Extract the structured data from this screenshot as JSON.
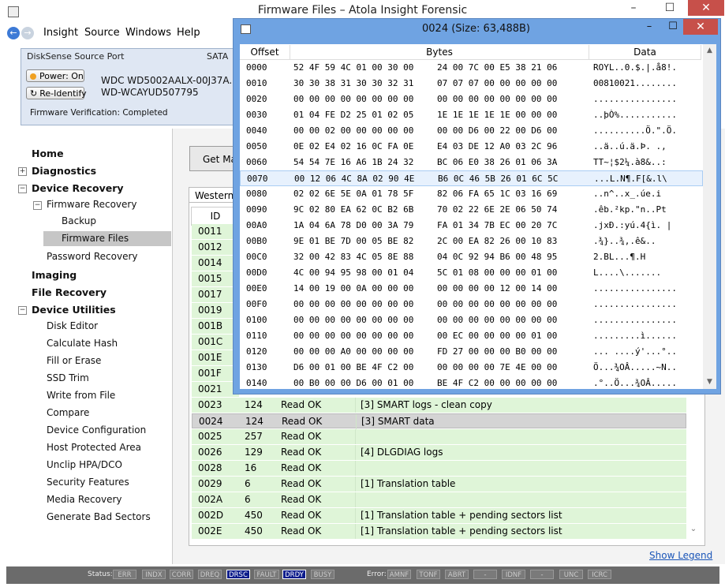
{
  "window": {
    "title": "Firmware Files – Atola Insight Forensic",
    "minimize": "–",
    "maximize": "☐",
    "close": "✕"
  },
  "nav_buttons": {
    "back": "←",
    "forward": "→"
  },
  "menu": [
    "Insight",
    "Source",
    "Windows",
    "Help"
  ],
  "source": {
    "title": "DiskSense Source Port",
    "interface": "SATA",
    "power_button": "Power: On",
    "reidentify_button": "Re-Identify",
    "model": "WDC WD5002AALX-00J37A...",
    "serial": "WD-WCAYUD507795",
    "fw_verification": "Firmware Verification: Completed"
  },
  "sidebar": {
    "home": "Home",
    "diagnostics": "Diagnostics",
    "device_recovery": "Device Recovery",
    "firmware_recovery": "Firmware Recovery",
    "backup": "Backup",
    "firmware_files": "Firmware Files",
    "password_recovery": "Password Recovery",
    "imaging": "Imaging",
    "file_recovery": "File Recovery",
    "device_utilities": "Device Utilities",
    "utilities": [
      "Disk Editor",
      "Calculate Hash",
      "Fill or Erase",
      "SSD Trim",
      "Write from File",
      "Compare",
      "Device Configuration",
      "Host Protected Area",
      "Unclip HPA/DCO",
      "Security Features",
      "Media Recovery",
      "Generate Bad Sectors"
    ],
    "expanders": {
      "collapsed": "+",
      "expanded": "−"
    }
  },
  "main": {
    "get_map_button": "Get Ma",
    "tab_label": "Western I",
    "id_header": "ID",
    "id_list": [
      "0011",
      "0012",
      "0014",
      "0015",
      "0017",
      "0019",
      "001B",
      "001C",
      "001E",
      "001F",
      "0021"
    ],
    "rows": [
      {
        "id": "0023",
        "size": "124",
        "status": "Read OK",
        "desc": "[3] SMART logs - clean copy"
      },
      {
        "id": "0024",
        "size": "124",
        "status": "Read OK",
        "desc": "[3] SMART data"
      },
      {
        "id": "0025",
        "size": "257",
        "status": "Read OK",
        "desc": ""
      },
      {
        "id": "0026",
        "size": "129",
        "status": "Read OK",
        "desc": "[4] DLGDIAG logs"
      },
      {
        "id": "0028",
        "size": "16",
        "status": "Read OK",
        "desc": ""
      },
      {
        "id": "0029",
        "size": "6",
        "status": "Read OK",
        "desc": "[1] Translation table"
      },
      {
        "id": "002A",
        "size": "6",
        "status": "Read OK",
        "desc": ""
      },
      {
        "id": "002D",
        "size": "450",
        "status": "Read OK",
        "desc": "[1] Translation table + pending sectors list"
      },
      {
        "id": "002E",
        "size": "450",
        "status": "Read OK",
        "desc": "[1] Translation table + pending sectors list"
      }
    ],
    "scroll_down": "⌄",
    "show_legend": "Show Legend"
  },
  "status_bar": {
    "status_label": "Status:",
    "status_indicators": [
      {
        "label": "ERR",
        "on": false
      },
      {
        "label": "INDX",
        "on": false
      },
      {
        "label": "CORR",
        "on": false
      },
      {
        "label": "DREQ",
        "on": false
      },
      {
        "label": "DRSC",
        "on": true
      },
      {
        "label": "FAULT",
        "on": false
      },
      {
        "label": "DRDY",
        "on": true
      },
      {
        "label": "BUSY",
        "on": false
      }
    ],
    "error_label": "Error:",
    "error_indicators": [
      "AMNF",
      "TONF",
      "ABRT",
      "-",
      "IDNF",
      "-",
      "UNC",
      "ICRC"
    ]
  },
  "hex_window": {
    "title": "0024 (Size: 63,488B)",
    "minimize": "–",
    "maximize": "☐",
    "close": "✕",
    "headers": [
      "Offset",
      "Bytes",
      "Data"
    ],
    "scroll_up": "▲",
    "scroll_down": "▼",
    "rows": [
      {
        "offset": "0000",
        "b1": "52 4F 59 4C 01 00 30 00",
        "b2": "24 00 7C 00 E5 38 21 06",
        "data": "ROYL..0.$.|.å8!."
      },
      {
        "offset": "0010",
        "b1": "30 30 38 31 30 30 32 31",
        "b2": "07 07 07 00 00 00 00 00",
        "data": "00810021........"
      },
      {
        "offset": "0020",
        "b1": "00 00 00 00 00 00 00 00",
        "b2": "00 00 00 00 00 00 00 00",
        "data": "................"
      },
      {
        "offset": "0030",
        "b1": "01 04 FE D2 25 01 02 05",
        "b2": "1E 1E 1E 1E 1E 00 00 00",
        "data": "..þÒ%..........."
      },
      {
        "offset": "0040",
        "b1": "00 00 02 00 00 00 00 00",
        "b2": "00 00 D6 00 22 00 D6 00",
        "data": "..........Ö.\".Ö."
      },
      {
        "offset": "0050",
        "b1": "0E 02 E4 02 16 0C FA 0E",
        "b2": "E4 03 DE 12 A0 03 2C 96",
        "data": "..ä..ú.ä.Þ. .,"
      },
      {
        "offset": "0060",
        "b1": "54 54 7E 16 A6 1B 24 32",
        "b2": "BC 06 E0 38 26 01 06 3A",
        "data": "TT~¦$2¼.à8&..:"
      },
      {
        "offset": "0070",
        "b1": "00 12 06 4C 8A 02 90 4E",
        "b2": "B6 0C 46 5B 26 01 6C 5C",
        "data": "...L.N¶.F[&.l\\"
      },
      {
        "offset": "0080",
        "b1": "02 02 6E 5E 0A 01 78 5F",
        "b2": "82 06 FA 65 1C 03 16 69",
        "data": "..n^..x_.úe.i"
      },
      {
        "offset": "0090",
        "b1": "9C 02 80 EA 62 0C B2 6B",
        "b2": "70 02 22 6E 2E 06 50 74",
        "data": ".êb.²kp.\"n..Pt"
      },
      {
        "offset": "00A0",
        "b1": "1A 04 6A 78 D0 00 3A 79",
        "b2": "FA 01 34 7B EC 00 20 7C",
        "data": ".jxÐ.:yú.4{ì. |"
      },
      {
        "offset": "00B0",
        "b1": "9E 01 BE 7D 00 05 BE 82",
        "b2": "2C 00 EA 82 26 00 10 83",
        "data": ".¾}..¾,.ê&.."
      },
      {
        "offset": "00C0",
        "b1": "32 00 42 83 4C 05 8E 88",
        "b2": "04 0C 92 94 B6 00 48 95",
        "data": "2.BL...¶.H"
      },
      {
        "offset": "00D0",
        "b1": "4C 00 94 95 98 00 01 04",
        "b2": "5C 01 08 00 00 00 01 00",
        "data": "L....\\......."
      },
      {
        "offset": "00E0",
        "b1": "14 00 19 00 0A 00 00 00",
        "b2": "00 00 00 00 12 00 14 00",
        "data": "................"
      },
      {
        "offset": "00F0",
        "b1": "00 00 00 00 00 00 00 00",
        "b2": "00 00 00 00 00 00 00 00",
        "data": "................"
      },
      {
        "offset": "0100",
        "b1": "00 00 00 00 00 00 00 00",
        "b2": "00 00 00 00 00 00 00 00",
        "data": "................"
      },
      {
        "offset": "0110",
        "b1": "00 00 00 00 00 00 00 00",
        "b2": "00 EC 00 00 00 00 01 00",
        "data": ".........ì......"
      },
      {
        "offset": "0120",
        "b1": "00 00 00 A0 00 00 00 00",
        "b2": "FD 27 00 00 00 B0 00 00",
        "data": "... ....ý'...°.."
      },
      {
        "offset": "0130",
        "b1": "D6 00 01 00 BE 4F C2 00",
        "b2": "00 00 00 00 7E 4E 00 00",
        "data": "Ö...¾OÂ.....~N.."
      },
      {
        "offset": "0140",
        "b1": "00 B0 00 00 D6 00 01 00",
        "b2": "BE 4F C2 00 00 00 00 00",
        "data": ".°..Ö...¾OÂ....."
      }
    ]
  },
  "colors": {
    "accent": "#6fa3e2",
    "close_red": "#c7504a",
    "row_green": "#dff5d8",
    "indicator_on": "#0c1c8c",
    "link": "#1a55b8"
  }
}
